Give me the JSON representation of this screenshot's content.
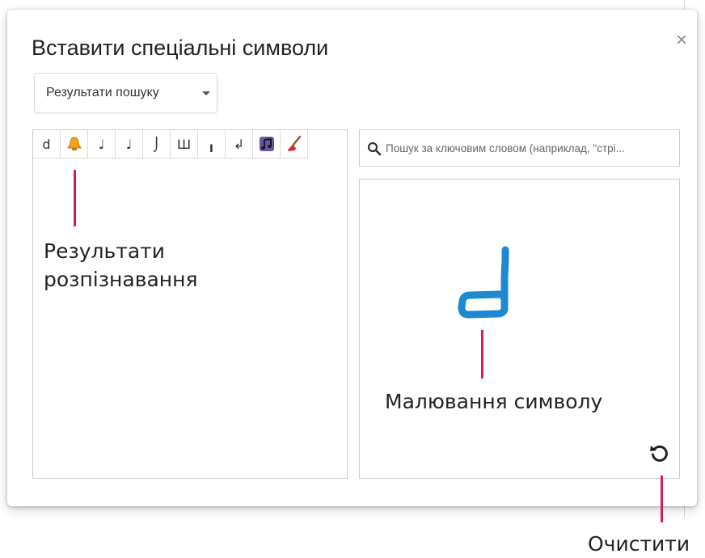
{
  "dialog": {
    "title": "Вставити спеціальні символи",
    "close_glyph": "×"
  },
  "dropdown": {
    "label": "Результати пошуку"
  },
  "results": {
    "symbols": [
      {
        "glyph": "d",
        "icon": null
      },
      {
        "glyph": "",
        "icon": "bell-emoji-icon"
      },
      {
        "glyph": "♩",
        "icon": null
      },
      {
        "glyph": "♩",
        "icon": null
      },
      {
        "glyph": "⌡",
        "icon": null
      },
      {
        "glyph": "Ш",
        "icon": null
      },
      {
        "glyph": "╻",
        "icon": null
      },
      {
        "glyph": "↲",
        "icon": null
      },
      {
        "glyph": "",
        "icon": "musical-notes-emoji-icon"
      },
      {
        "glyph": "",
        "icon": "broom-emoji-icon"
      }
    ]
  },
  "search": {
    "placeholder": "Пошук за ключовим словом (наприклад, \"стрі..."
  },
  "drawing": {
    "stroke_color": "#1e88d0"
  },
  "annotations": {
    "results_line1": "Результати",
    "results_line2": "розпізнавання",
    "drawing": "Малювання символу",
    "clear": "Очистити",
    "accent_color": "#d81b60"
  }
}
